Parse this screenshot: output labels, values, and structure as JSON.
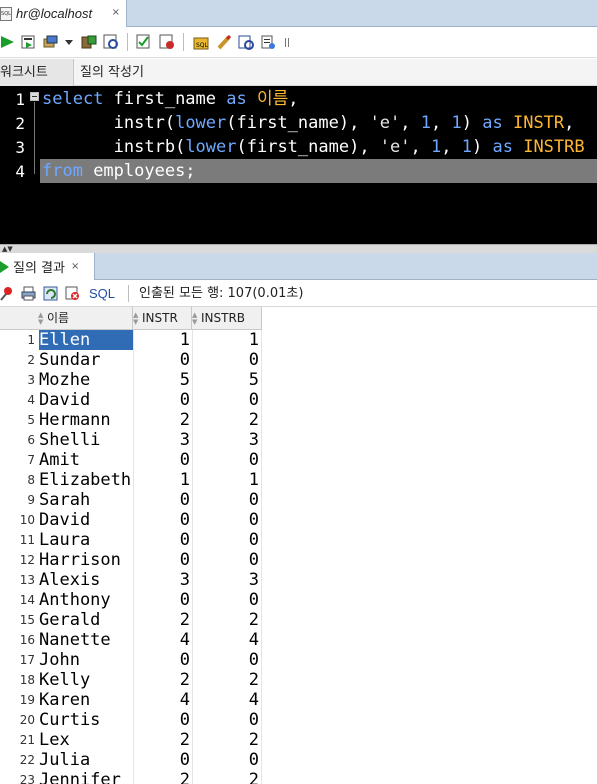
{
  "document_tab": {
    "title": "hr@localhost",
    "close": "×",
    "icon": "sql-file-icon"
  },
  "toolbar": {
    "icons": [
      "run-statement-icon",
      "run-script-icon",
      "commit-icon",
      "dropdown-icon",
      "rollback-icon",
      "explain-plan-icon",
      "autotrace-icon",
      "sql-tuning-icon",
      "clear-icon",
      "history-icon",
      "unshared-worksheet-icon",
      "format-icon"
    ]
  },
  "sub_tabs": {
    "worksheet": "워크시트",
    "query_builder": "질의 작성기"
  },
  "editor": {
    "line_numbers": [
      "1",
      "2",
      "3",
      "4"
    ],
    "line1": {
      "k1": "select",
      "t1": " first_name ",
      "k2": "as",
      "t2": " ",
      "a1": "이름",
      "t3": ","
    },
    "line2": {
      "indent": "       ",
      "f1": "instr(",
      "k1": "lower",
      "t1": "(first_name), ",
      "s1": "'e'",
      "t2": ", ",
      "n1": "1",
      "t3": ", ",
      "n2": "1",
      "t4": ") ",
      "k2": "as",
      "t5": " ",
      "a1": "INSTR",
      "t6": ","
    },
    "line3": {
      "indent": "       ",
      "f1": "instrb(",
      "k1": "lower",
      "t1": "(first_name), ",
      "s1": "'e'",
      "t2": ", ",
      "n1": "1",
      "t3": ", ",
      "n2": "1",
      "t4": ") ",
      "k2": "as",
      "t5": " ",
      "a1": "INSTRB"
    },
    "line4": {
      "k1": "from",
      "t1": " employees;"
    }
  },
  "results_tab": {
    "label": "질의 결과",
    "close": "×"
  },
  "results_toolbar": {
    "sql_link": "SQL",
    "status": "인출된 모든 행: 107(0.01초)",
    "icons": [
      "pin-icon",
      "print-icon",
      "refresh-icon",
      "cancel-icon"
    ]
  },
  "grid": {
    "headers": {
      "name": "이름",
      "instr": "INSTR",
      "instrb": "INSTRB"
    },
    "selected_row": 1,
    "rows": [
      {
        "n": "1",
        "name": "Ellen",
        "instr": "1",
        "instrb": "1"
      },
      {
        "n": "2",
        "name": "Sundar",
        "instr": "0",
        "instrb": "0"
      },
      {
        "n": "3",
        "name": "Mozhe",
        "instr": "5",
        "instrb": "5"
      },
      {
        "n": "4",
        "name": "David",
        "instr": "0",
        "instrb": "0"
      },
      {
        "n": "5",
        "name": "Hermann",
        "instr": "2",
        "instrb": "2"
      },
      {
        "n": "6",
        "name": "Shelli",
        "instr": "3",
        "instrb": "3"
      },
      {
        "n": "7",
        "name": "Amit",
        "instr": "0",
        "instrb": "0"
      },
      {
        "n": "8",
        "name": "Elizabeth",
        "instr": "1",
        "instrb": "1"
      },
      {
        "n": "9",
        "name": "Sarah",
        "instr": "0",
        "instrb": "0"
      },
      {
        "n": "10",
        "name": "David",
        "instr": "0",
        "instrb": "0"
      },
      {
        "n": "11",
        "name": "Laura",
        "instr": "0",
        "instrb": "0"
      },
      {
        "n": "12",
        "name": "Harrison",
        "instr": "0",
        "instrb": "0"
      },
      {
        "n": "13",
        "name": "Alexis",
        "instr": "3",
        "instrb": "3"
      },
      {
        "n": "14",
        "name": "Anthony",
        "instr": "0",
        "instrb": "0"
      },
      {
        "n": "15",
        "name": "Gerald",
        "instr": "2",
        "instrb": "2"
      },
      {
        "n": "16",
        "name": "Nanette",
        "instr": "4",
        "instrb": "4"
      },
      {
        "n": "17",
        "name": "John",
        "instr": "0",
        "instrb": "0"
      },
      {
        "n": "18",
        "name": "Kelly",
        "instr": "2",
        "instrb": "2"
      },
      {
        "n": "19",
        "name": "Karen",
        "instr": "4",
        "instrb": "4"
      },
      {
        "n": "20",
        "name": "Curtis",
        "instr": "0",
        "instrb": "0"
      },
      {
        "n": "21",
        "name": "Lex",
        "instr": "2",
        "instrb": "2"
      },
      {
        "n": "22",
        "name": "Julia",
        "instr": "0",
        "instrb": "0"
      },
      {
        "n": "23",
        "name": "Jennifer",
        "instr": "2",
        "instrb": "2"
      }
    ]
  }
}
